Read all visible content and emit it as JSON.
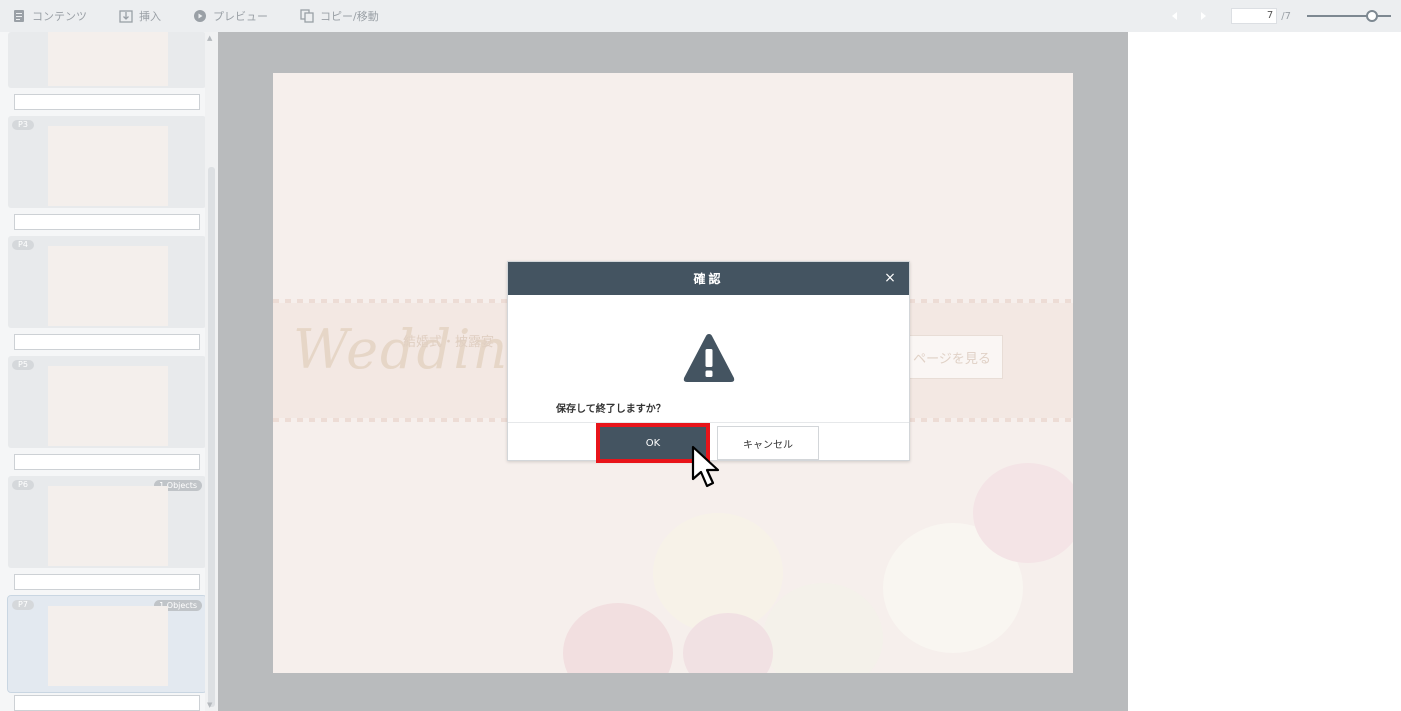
{
  "toolbar": {
    "contents_label": "コンテンツ",
    "insert_label": "挿入",
    "preview_label": "プレビュー",
    "copy_move_label": "コピー/移動",
    "current_page": "7",
    "total_pages": "/7",
    "zoom_level": 0.82
  },
  "sidebar": {
    "pages": [
      {
        "label": "",
        "badge": ""
      },
      {
        "label": "P3",
        "badge": ""
      },
      {
        "label": "P4",
        "badge": ""
      },
      {
        "label": "P5",
        "badge": ""
      },
      {
        "label": "P6",
        "badge": "1 Objects"
      },
      {
        "label": "P7",
        "badge": "1 Objects"
      }
    ]
  },
  "canvas": {
    "script_title": "Wedding Pla",
    "jp_subtitle": "結婚式・披露宴",
    "view_page_button": "ページを見る"
  },
  "dialog": {
    "title": "確認",
    "close_symbol": "×",
    "message": "保存して終了しますか？",
    "ok_label": "OK",
    "cancel_label": "キャンセル"
  },
  "colors": {
    "dialog_header": "#445461",
    "highlight": "#e8141a",
    "canvas_backdrop": "#b9bbbd"
  }
}
